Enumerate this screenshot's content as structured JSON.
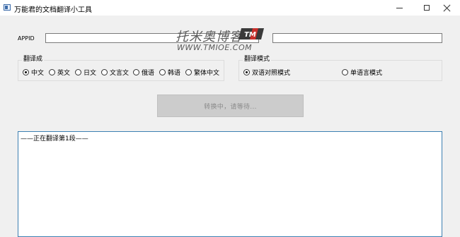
{
  "window": {
    "title": "万能君的文档翻译小工具",
    "controls": [
      "minimize-icon",
      "maximize-icon",
      "close-icon"
    ]
  },
  "appid": {
    "label": "APPID",
    "value": "",
    "secret_value": ""
  },
  "watermark": {
    "text_cn": "托米奥博客",
    "text_en": "WWW.TMIOE.COM",
    "logo_text": "TM"
  },
  "translate_to": {
    "title": "翻译成",
    "options": [
      "中文",
      "英文",
      "日文",
      "文言文",
      "俄语",
      "韩语",
      "繁体中文"
    ],
    "selected": "中文"
  },
  "translate_mode": {
    "title": "翻译模式",
    "options": [
      "双语对照模式",
      "单语言模式"
    ],
    "selected": "双语对照模式"
  },
  "action": {
    "button_label": "转换中，请等待..."
  },
  "output": {
    "text": "——正在翻译第1段——"
  }
}
